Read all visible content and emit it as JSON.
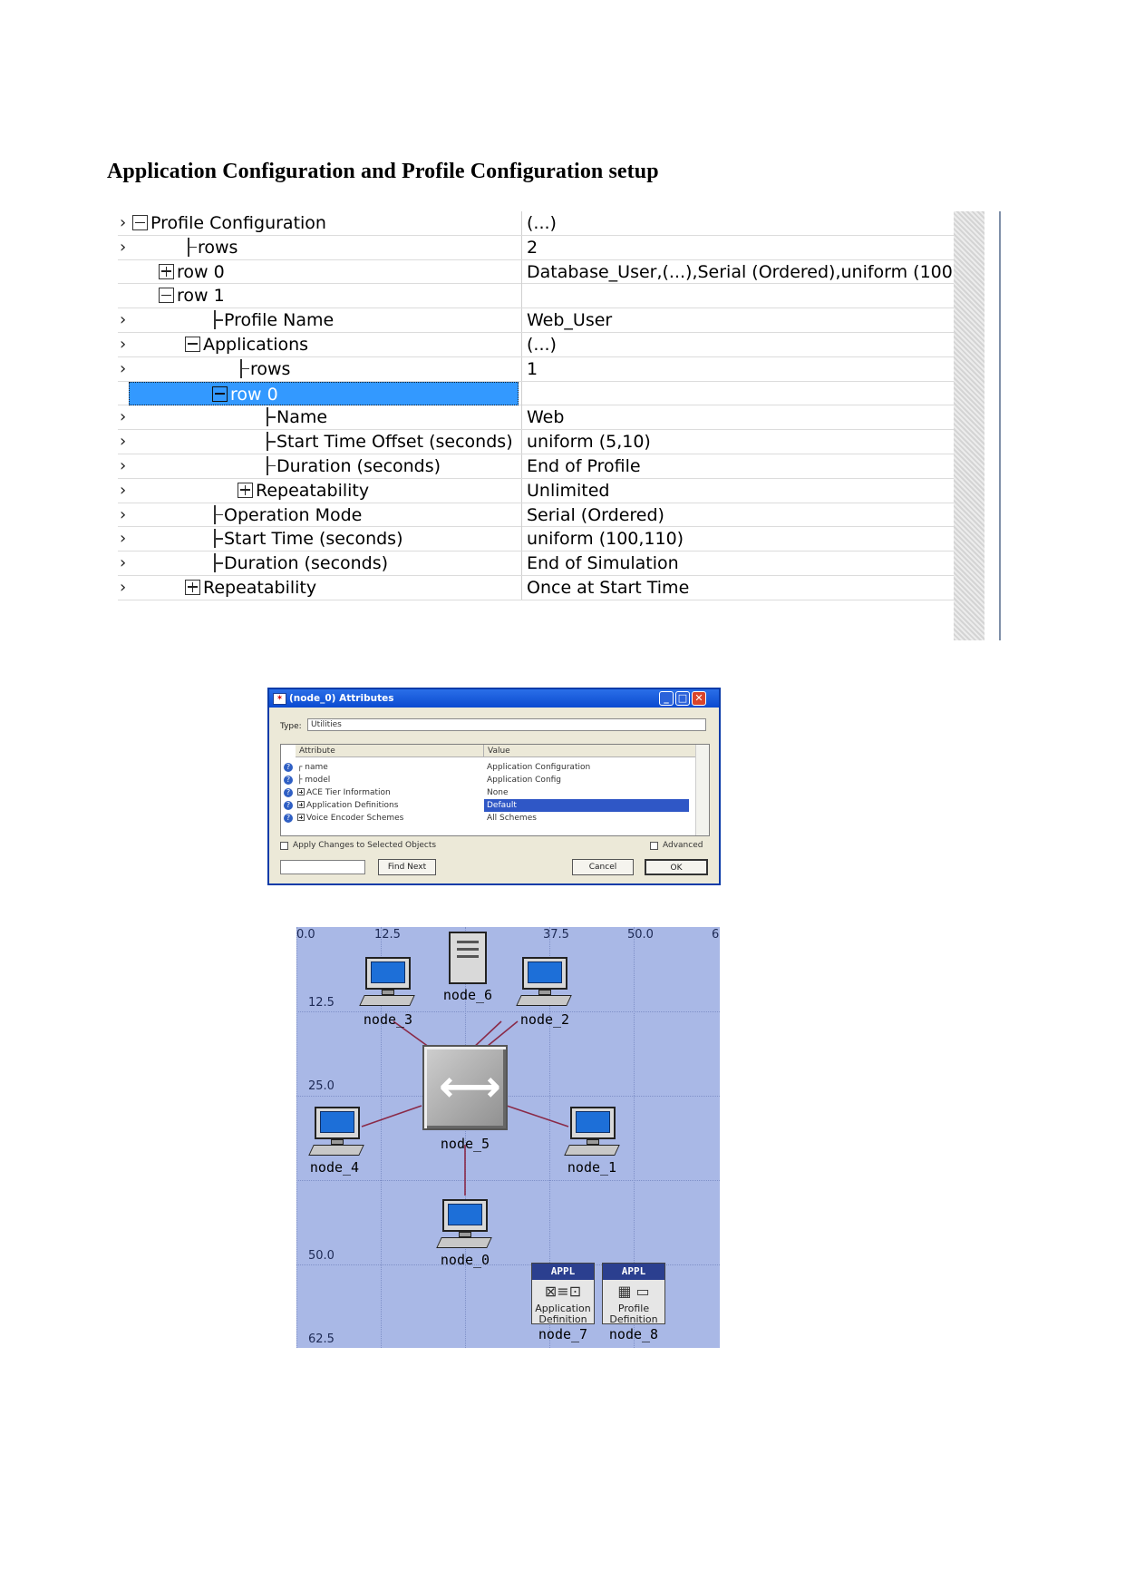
{
  "heading": "Application Configuration and Profile Configuration setup",
  "profile_tree": {
    "rows": [
      {
        "mark": "›",
        "toggle": "minus",
        "indent": 0,
        "label": "Profile Configuration",
        "value": "(...)"
      },
      {
        "mark": "›",
        "toggle": "tee",
        "indent": 2,
        "label": "rows",
        "value": "2"
      },
      {
        "mark": "",
        "toggle": "plus",
        "indent": 1,
        "label": "row 0",
        "value": "Database_User,(...),Serial (Ordered),uniform (100..."
      },
      {
        "mark": "",
        "toggle": "minus",
        "indent": 1,
        "label": "row 1",
        "value": ""
      },
      {
        "mark": "›",
        "toggle": "tee",
        "indent": 3,
        "label": "Profile Name",
        "value": "Web_User"
      },
      {
        "mark": "›",
        "toggle": "minus",
        "indent": 2,
        "label": "Applications",
        "value": "(...)"
      },
      {
        "mark": "›",
        "toggle": "tee",
        "indent": 4,
        "label": "rows",
        "value": "1"
      },
      {
        "mark": "",
        "toggle": "minus",
        "indent": 3,
        "label": "row 0",
        "value": "",
        "selected": true
      },
      {
        "mark": "›",
        "toggle": "tee",
        "indent": 5,
        "label": "Name",
        "value": "Web"
      },
      {
        "mark": "›",
        "toggle": "tee",
        "indent": 5,
        "label": "Start Time Offset (seconds)",
        "value": "uniform (5,10)"
      },
      {
        "mark": "›",
        "toggle": "tee",
        "indent": 5,
        "label": "Duration (seconds)",
        "value": "End of Profile"
      },
      {
        "mark": "›",
        "toggle": "plus",
        "indent": 4,
        "label": "Repeatability",
        "value": "Unlimited"
      },
      {
        "mark": "›",
        "toggle": "tee",
        "indent": 3,
        "label": "Operation Mode",
        "value": "Serial (Ordered)"
      },
      {
        "mark": "›",
        "toggle": "tee",
        "indent": 3,
        "label": "Start Time (seconds)",
        "value": "uniform (100,110)"
      },
      {
        "mark": "›",
        "toggle": "tee",
        "indent": 3,
        "label": "Duration (seconds)",
        "value": "End of Simulation"
      },
      {
        "mark": "›",
        "toggle": "plus",
        "indent": 2,
        "label": "Repeatability",
        "value": "Once at Start Time"
      }
    ]
  },
  "dialog": {
    "title": "(node_0) Attributes",
    "type_label": "Type:",
    "type_value": "Utilities",
    "col_attribute": "Attribute",
    "col_value": "Value",
    "rows": [
      {
        "attr": "name",
        "value": "Application Configuration",
        "expand": false
      },
      {
        "attr": "model",
        "value": "Application Config",
        "expand": false
      },
      {
        "attr": "ACE Tier Information",
        "value": "None",
        "expand": true
      },
      {
        "attr": "Application Definitions",
        "value": "Default",
        "expand": true,
        "highlight": true
      },
      {
        "attr": "Voice Encoder Schemes",
        "value": "All Schemes",
        "expand": true
      }
    ],
    "apply_label": "Apply Changes to Selected Objects",
    "advanced_label": "Advanced",
    "find_next": "Find Next",
    "cancel": "Cancel",
    "ok": "OK"
  },
  "network": {
    "x_ticks": [
      "0.0",
      "12.5",
      "37.5",
      "50.0",
      "6"
    ],
    "y_ticks": [
      "12.5",
      "25.0",
      "50.0",
      "62.5"
    ],
    "nodes": {
      "node_0": "node_0",
      "node_1": "node_1",
      "node_2": "node_2",
      "node_3": "node_3",
      "node_4": "node_4",
      "node_5": "node_5",
      "node_6": "node_6",
      "node_7": "node_7",
      "node_8": "node_8"
    },
    "appl_header": "APPL",
    "appl_def_text": "Application Definition",
    "profile_def_text": "Profile Definition"
  }
}
